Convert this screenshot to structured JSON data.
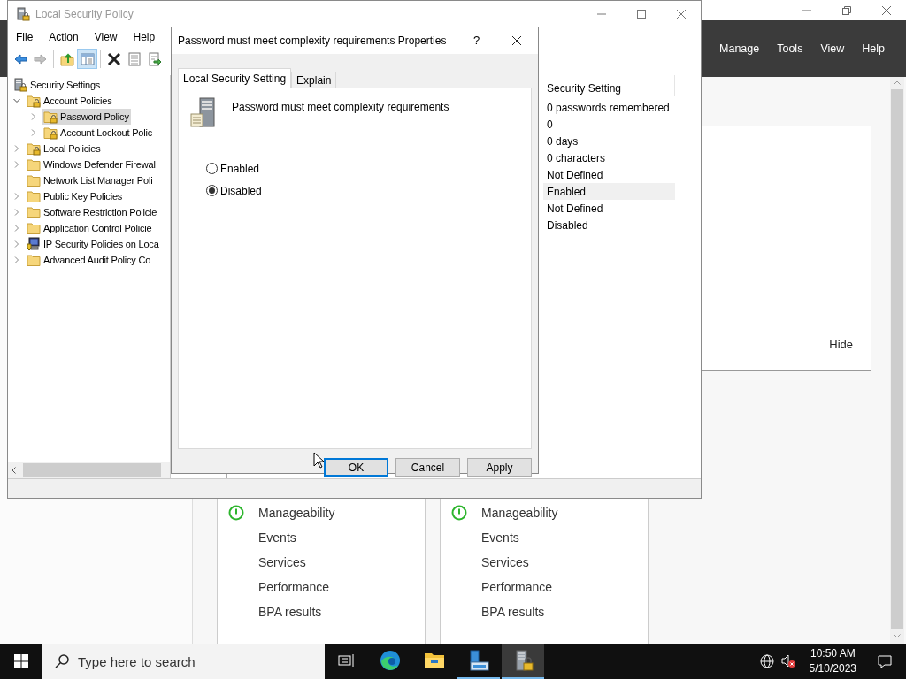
{
  "server_manager": {
    "menu": [
      "Manage",
      "Tools",
      "View",
      "Help"
    ],
    "hide_link": "Hide",
    "tiles": [
      {
        "items": [
          {
            "label": "Manageability",
            "kind": "status-ok"
          },
          {
            "label": "Events",
            "kind": "plain"
          },
          {
            "label": "Services",
            "kind": "plain"
          },
          {
            "label": "Performance",
            "kind": "plain"
          },
          {
            "label": "BPA results",
            "kind": "plain"
          }
        ]
      },
      {
        "items": [
          {
            "label": "Manageability",
            "kind": "status-ok"
          },
          {
            "label": "Events",
            "kind": "plain"
          },
          {
            "label": "Services",
            "kind": "plain"
          },
          {
            "label": "Performance",
            "kind": "plain"
          },
          {
            "label": "BPA results",
            "kind": "plain"
          }
        ]
      }
    ]
  },
  "lsp": {
    "title": "Local Security Policy",
    "menu": [
      "File",
      "Action",
      "View",
      "Help"
    ],
    "toolbar": [
      {
        "kind": "back",
        "disabled": false,
        "pressed": false
      },
      {
        "kind": "forward",
        "disabled": true,
        "pressed": false
      },
      {
        "kind": "separator"
      },
      {
        "kind": "up",
        "disabled": false,
        "pressed": false
      },
      {
        "kind": "tree",
        "disabled": false,
        "pressed": true
      },
      {
        "kind": "separator"
      },
      {
        "kind": "delete",
        "disabled": false,
        "pressed": false
      },
      {
        "kind": "properties",
        "disabled": false,
        "pressed": false
      },
      {
        "kind": "export",
        "disabled": false,
        "pressed": false
      }
    ],
    "tree": [
      {
        "label": "Security Settings",
        "kind": "lock-server",
        "selected": false,
        "children": [
          {
            "label": "Account Policies",
            "kind": "lock-folder",
            "expanded": true,
            "selected": false,
            "children": [
              {
                "label": "Password Policy",
                "kind": "lock-folder",
                "expanded": false,
                "selected": true
              },
              {
                "label": "Account Lockout Polic",
                "kind": "lock-folder",
                "expanded": false,
                "selected": false
              }
            ]
          },
          {
            "label": "Local Policies",
            "kind": "lock-folder",
            "expanded": false,
            "selected": false
          },
          {
            "label": "Windows Defender Firewal",
            "kind": "folder",
            "expanded": false,
            "selected": false
          },
          {
            "label": "Network List Manager Poli",
            "kind": "folder",
            "selected": false
          },
          {
            "label": "Public Key Policies",
            "kind": "folder",
            "expanded": false,
            "selected": false
          },
          {
            "label": "Software Restriction Policie",
            "kind": "folder",
            "expanded": false,
            "selected": false
          },
          {
            "label": "Application Control Policie",
            "kind": "folder",
            "expanded": false,
            "selected": false
          },
          {
            "label": "IP Security Policies on Loca",
            "kind": "ip-security",
            "expanded": false,
            "selected": false
          },
          {
            "label": "Advanced Audit Policy Co",
            "kind": "folder",
            "expanded": false,
            "selected": false
          }
        ]
      }
    ],
    "column_header": "Security Setting",
    "rows": [
      {
        "value": "0 passwords remembered",
        "selected": false
      },
      {
        "value": "0",
        "selected": false
      },
      {
        "value": "0 days",
        "selected": false
      },
      {
        "value": "0 characters",
        "selected": false
      },
      {
        "value": "Not Defined",
        "selected": false
      },
      {
        "value": "Enabled",
        "selected": true
      },
      {
        "value": "Not Defined",
        "selected": false
      },
      {
        "value": "Disabled",
        "selected": false
      }
    ]
  },
  "dialog": {
    "title": "Password must meet complexity requirements Properties",
    "help": "?",
    "tabs": [
      {
        "label": "Local Security Setting",
        "selected": true
      },
      {
        "label": "Explain",
        "selected": false
      }
    ],
    "policy": "Password must meet complexity requirements",
    "options": [
      {
        "label": "Enabled",
        "selected": false
      },
      {
        "label": "Disabled",
        "selected": true
      }
    ],
    "buttons": [
      {
        "label": "OK",
        "default": true
      },
      {
        "label": "Cancel",
        "default": false
      },
      {
        "label": "Apply",
        "default": false
      }
    ]
  },
  "taskbar": {
    "search_placeholder": "Type here to search",
    "apps": [
      {
        "kind": "task-view",
        "running": false,
        "selected": false
      },
      {
        "kind": "edge",
        "running": false,
        "selected": false
      },
      {
        "kind": "explorer",
        "running": false,
        "selected": false
      },
      {
        "kind": "server-manager",
        "running": true,
        "selected": false
      },
      {
        "kind": "security-policy",
        "running": true,
        "selected": true
      }
    ],
    "time": "10:50 AM",
    "date": "5/10/2023"
  }
}
